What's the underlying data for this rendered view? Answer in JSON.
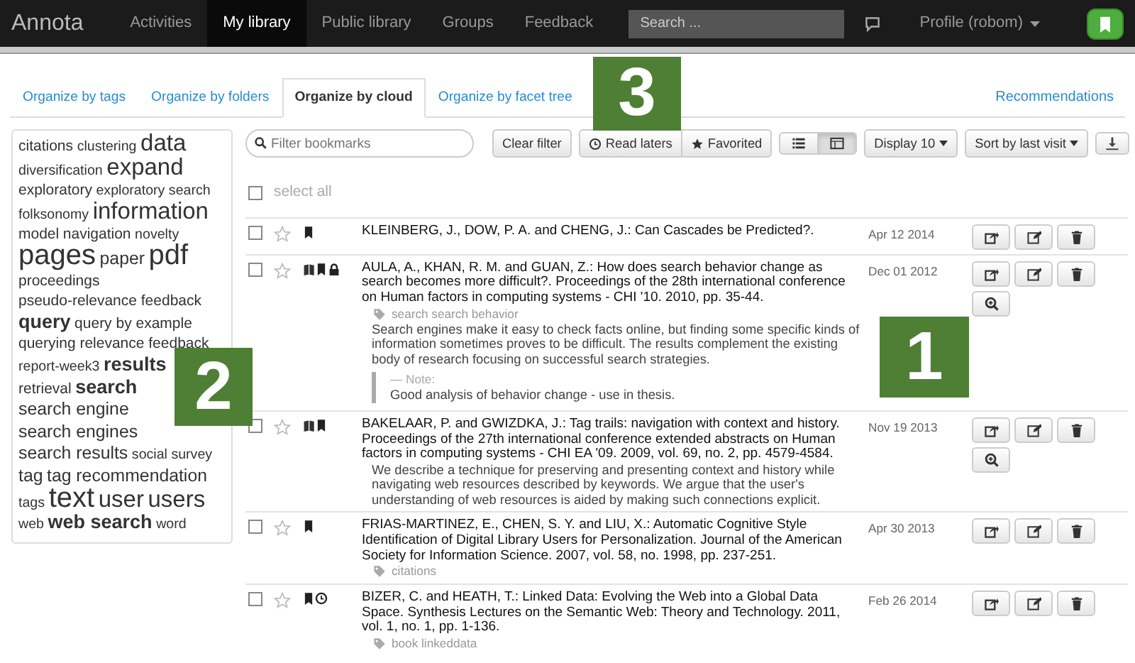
{
  "navbar": {
    "brand": "Annota",
    "items": [
      {
        "label": "Activities",
        "selected": false
      },
      {
        "label": "My library",
        "selected": true
      },
      {
        "label": "Public library",
        "selected": false
      },
      {
        "label": "Groups",
        "selected": false
      },
      {
        "label": "Feedback",
        "selected": false
      }
    ],
    "search": {
      "placeholder": "Search ..."
    },
    "profile": "Profile (robom)"
  },
  "tabs": [
    {
      "label": "Organize by tags",
      "selected": false
    },
    {
      "label": "Organize by folders",
      "selected": false
    },
    {
      "label": "Organize by cloud",
      "selected": true
    },
    {
      "label": "Organize by facet tree",
      "selected": false
    }
  ],
  "recommendations": "Recommendations",
  "cloud": [
    {
      "tag": "citations",
      "kind": "m"
    },
    {
      "tag": "clustering",
      "kind": "s"
    },
    {
      "tag": "data",
      "kind": "l"
    },
    {
      "tag": "diversification",
      "kind": "s"
    },
    {
      "tag": "expand",
      "kind": "l"
    },
    {
      "tag": "exploratory",
      "kind": "m"
    },
    {
      "tag": "exploratory search",
      "kind": "s"
    },
    {
      "tag": "folksonomy",
      "kind": "s"
    },
    {
      "tag": "information",
      "kind": "l"
    },
    {
      "tag": "model",
      "kind": "m"
    },
    {
      "tag": "navigation",
      "kind": "m"
    },
    {
      "tag": "novelty",
      "kind": "s"
    },
    {
      "tag": "pages",
      "kind": "xl"
    },
    {
      "tag": "paper",
      "kind": "ml"
    },
    {
      "tag": "pdf",
      "kind": "xl"
    },
    {
      "tag": "proceedings",
      "kind": "m"
    },
    {
      "tag": "pseudo-relevance feedback",
      "kind": "m"
    },
    {
      "tag": "query",
      "kind": "lb"
    },
    {
      "tag": "query by example",
      "kind": "m"
    },
    {
      "tag": "querying relevance feedback",
      "kind": "m"
    },
    {
      "tag": "report-week3",
      "kind": "s"
    },
    {
      "tag": "results",
      "kind": "lb"
    },
    {
      "tag": "retrieval",
      "kind": "m"
    },
    {
      "tag": "search",
      "kind": "lb"
    },
    {
      "tag": "search engine",
      "kind": "ml"
    },
    {
      "tag": "search engines",
      "kind": "ml"
    },
    {
      "tag": "search results",
      "kind": "ml"
    },
    {
      "tag": "social survey",
      "kind": "s"
    },
    {
      "tag": "tag",
      "kind": "ml"
    },
    {
      "tag": "tag recommendation",
      "kind": "ml"
    },
    {
      "tag": "tags",
      "kind": "s"
    },
    {
      "tag": "text",
      "kind": "xl"
    },
    {
      "tag": "user",
      "kind": "l"
    },
    {
      "tag": "users",
      "kind": "l"
    },
    {
      "tag": "web",
      "kind": "s"
    },
    {
      "tag": "web search",
      "kind": "lb"
    },
    {
      "tag": "word",
      "kind": "s"
    }
  ],
  "toolbar": {
    "filter": {
      "placeholder": "Filter bookmarks"
    },
    "clear": "Clear filter",
    "read_laters": "Read laters",
    "favorited": "Favorited",
    "views": [
      {
        "kind": "list",
        "selected": false
      },
      {
        "kind": "grid",
        "selected": true
      }
    ],
    "display": "Display 10",
    "sort": "Sort by last visit"
  },
  "select_all": {
    "label": "select all",
    "checked": false
  },
  "bookmarks": [
    {
      "checked": false,
      "favorite": false,
      "indicators": [
        {
          "kind": "bookmark"
        }
      ],
      "citation": "KLEINBERG, J., DOW, P. A. and CHENG, J.: Can Cascades be Predicted?.",
      "date": "Apr 12 2014",
      "actions": [
        {
          "kind": "share"
        },
        {
          "kind": "edit"
        },
        {
          "kind": "delete"
        }
      ]
    },
    {
      "checked": false,
      "favorite": false,
      "indicators": [
        {
          "kind": "book"
        },
        {
          "kind": "bookmark"
        },
        {
          "kind": "lock"
        }
      ],
      "citation": "AULA, A., KHAN, R. M. and GUAN, Z.: How does search behavior change as search becomes more difficult?. Proceedings of the 28th international conference on Human factors in computing systems - CHI '10. 2010, pp. 35-44.",
      "date": "Dec 01 2012",
      "actions": [
        {
          "kind": "share"
        },
        {
          "kind": "edit"
        },
        {
          "kind": "delete"
        },
        {
          "kind": "zoom"
        }
      ],
      "tags": "search search behavior",
      "abstract": "Search engines make it easy to check facts online, but finding some specific kinds of information sometimes proves to be difficult. The results complement the existing body of research focusing on successful search strategies.",
      "note": {
        "label": "— Note:",
        "text": "Good analysis of behavior change - use in thesis."
      }
    },
    {
      "checked": false,
      "favorite": false,
      "indicators": [
        {
          "kind": "book"
        },
        {
          "kind": "bookmark"
        }
      ],
      "citation": "BAKELAAR, P. and GWIZDKA, J.: Tag trails: navigation with context and history. Proceedings of the 27th international conference extended abstracts on Human factors in computing systems - CHI EA '09. 2009, vol. 69, no. 2, pp. 4579-4584.",
      "date": "Nov 19 2013",
      "actions": [
        {
          "kind": "share"
        },
        {
          "kind": "edit"
        },
        {
          "kind": "delete"
        },
        {
          "kind": "zoom"
        }
      ],
      "abstract": "We describe a technique for preserving and presenting context and history while navigating web resources described by keywords. We argue that the user's understanding of web resources is aided by making such connections explicit."
    },
    {
      "checked": false,
      "favorite": false,
      "indicators": [
        {
          "kind": "bookmark"
        }
      ],
      "citation": "FRIAS-MARTINEZ, E., CHEN, S. Y. and LIU, X.: Automatic Cognitive Style Identification of Digital Library Users for Personalization. Journal of the American Society for Information Science. 2007, vol. 58, no. 1998, pp. 237-251.",
      "date": "Apr 30 2013",
      "actions": [
        {
          "kind": "share"
        },
        {
          "kind": "edit"
        },
        {
          "kind": "delete"
        }
      ],
      "tags": "citations"
    },
    {
      "checked": false,
      "favorite": false,
      "indicators": [
        {
          "kind": "bookmark"
        },
        {
          "kind": "clock"
        }
      ],
      "citation": "BIZER, C. and HEATH, T.: Linked Data: Evolving the Web into a Global Data Space. Synthesis Lectures on the Semantic Web: Theory and Technology. 2011, vol. 1, no. 1, pp. 1-136.",
      "date": "Feb 26 2014",
      "actions": [
        {
          "kind": "share"
        },
        {
          "kind": "edit"
        },
        {
          "kind": "delete"
        }
      ],
      "tags": "book linkeddata"
    }
  ],
  "callouts": [
    {
      "label": "3"
    },
    {
      "label": "2"
    },
    {
      "label": "1"
    }
  ]
}
